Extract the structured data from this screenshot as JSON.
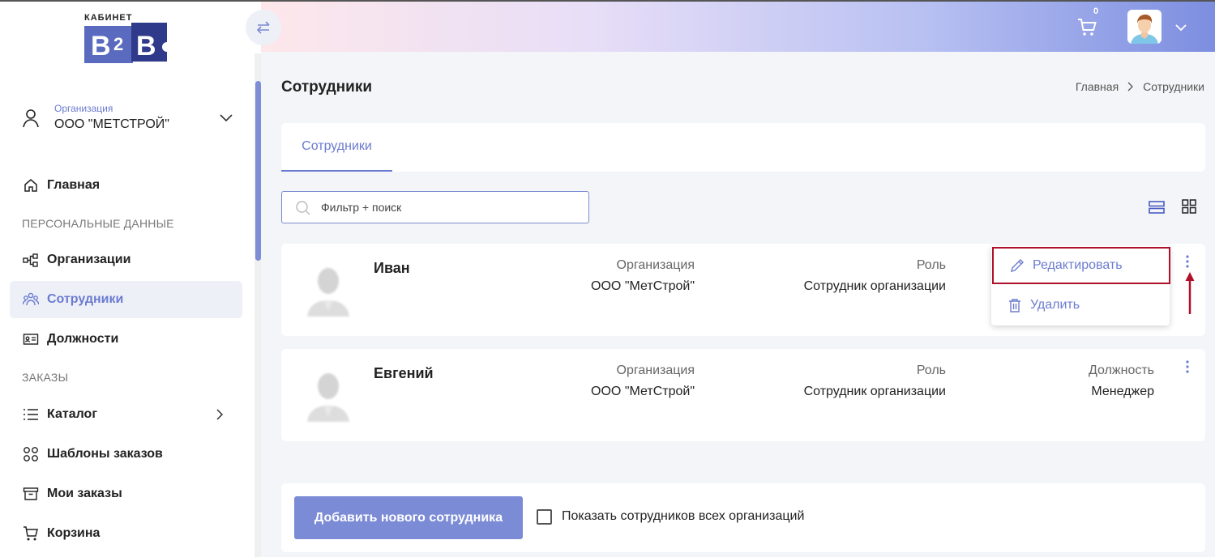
{
  "logo": {
    "small_text": "КАБИНЕТ",
    "big_text": "B2B"
  },
  "org": {
    "label": "Организация",
    "name": "ООО \"МЕТСТРОЙ\""
  },
  "nav": {
    "home": "Главная",
    "section_personal": "ПЕРСОНАЛЬНЫЕ ДАННЫЕ",
    "organizations": "Организации",
    "employees": "Сотрудники",
    "positions": "Должности",
    "section_orders": "ЗАКАЗЫ",
    "catalog": "Каталог",
    "order_templates": "Шаблоны заказов",
    "my_orders": "Мои заказы",
    "cart": "Корзина"
  },
  "header": {
    "cart_count": "0"
  },
  "page": {
    "title": "Сотрудники",
    "breadcrumb": [
      "Главная",
      "Сотрудники"
    ],
    "tab": "Сотрудники",
    "search_placeholder": "Фильтр + поиск"
  },
  "employees": [
    {
      "name": "Иван",
      "org_label": "Организация",
      "org": "ООО \"МетСтрой\"",
      "role_label": "Роль",
      "role": "Сотрудник организации"
    },
    {
      "name": "Евгений",
      "org_label": "Организация",
      "org": "ООО \"МетСтрой\"",
      "role_label": "Роль",
      "role": "Сотрудник организации",
      "position_label": "Должность",
      "position": "Менеджер"
    }
  ],
  "menu": {
    "edit": "Редактировать",
    "delete": "Удалить"
  },
  "footer": {
    "add_button": "Добавить нового сотрудника",
    "show_all_label": "Показать сотрудников всех организаций"
  },
  "colors": {
    "accent": "#6b7bd0",
    "highlight_border": "#b0102a",
    "button": "#7b8bd6"
  }
}
